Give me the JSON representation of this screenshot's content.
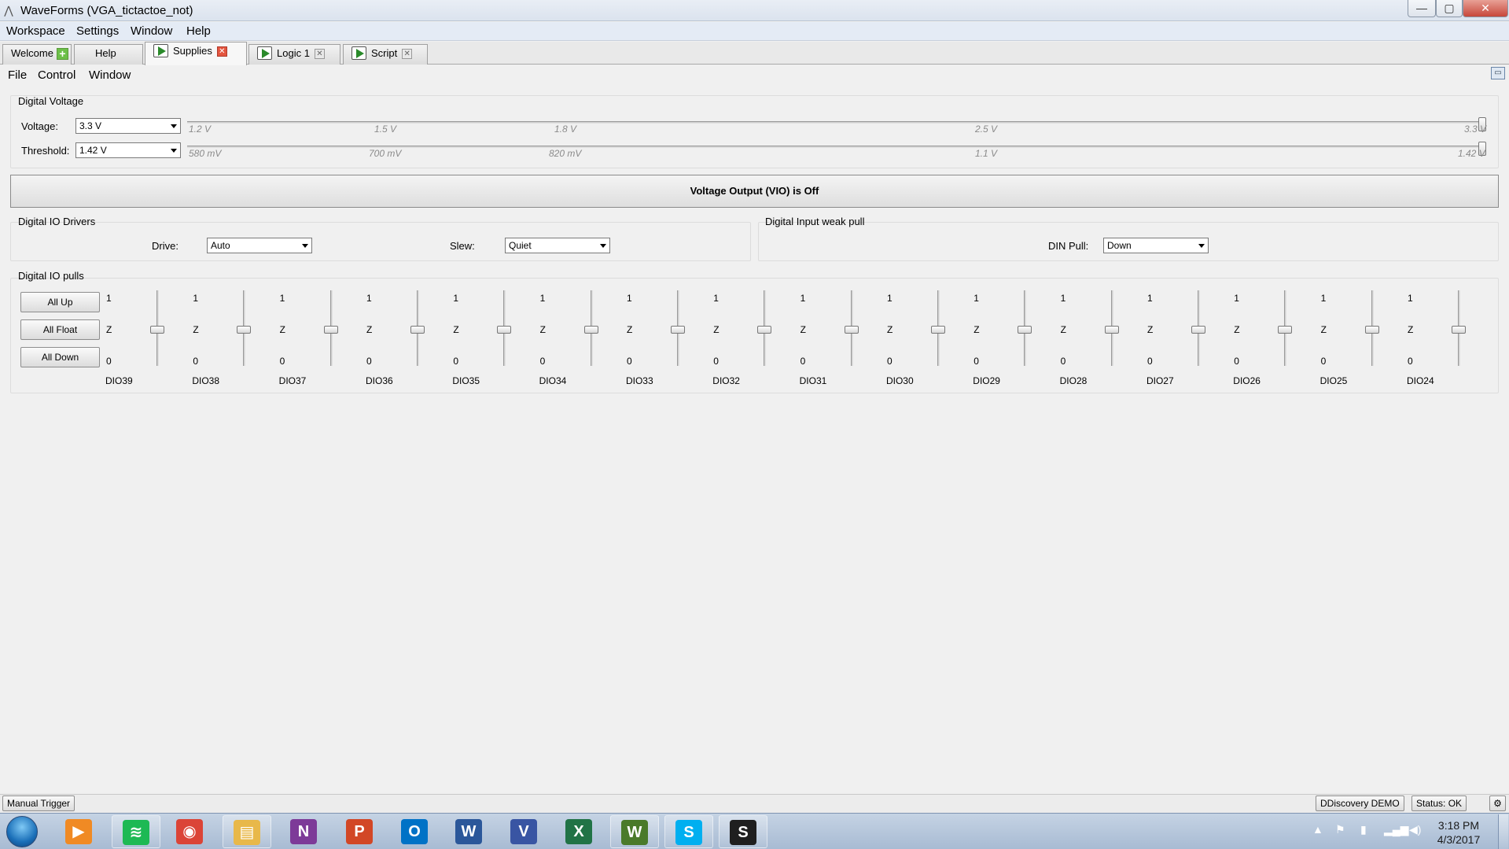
{
  "window": {
    "title": "WaveForms   (VGA_tictactoe_not)",
    "min_glyph": "—",
    "max_glyph": "▢",
    "close_glyph": "✕"
  },
  "app_menu": [
    "Workspace",
    "Settings",
    "Window",
    "Help"
  ],
  "tabs": [
    {
      "label": "Welcome",
      "icon": "plus-icon"
    },
    {
      "label": "Help",
      "icon": ""
    },
    {
      "label": "Supplies",
      "icon": "play-icon",
      "active": true
    },
    {
      "label": "Logic 1",
      "icon": "play-icon"
    },
    {
      "label": "Script",
      "icon": "play-icon"
    }
  ],
  "sub_menu": [
    "File",
    "Control",
    "Window"
  ],
  "digital_voltage": {
    "title": "Digital Voltage",
    "voltage_label": "Voltage:",
    "voltage_value": "3.3 V",
    "voltage_ticks": [
      "1.2 V",
      "1.5 V",
      "1.8 V",
      "2.5 V",
      "3.3 V"
    ],
    "threshold_label": "Threshold:",
    "threshold_value": "1.42 V",
    "threshold_ticks": [
      "580 mV",
      "700 mV",
      "820 mV",
      "1.1 V",
      "1.42 V"
    ]
  },
  "banner": "Voltage Output (VIO) is Off",
  "io_drivers": {
    "title": "Digital IO Drivers",
    "drive_label": "Drive:",
    "drive_value": "Auto",
    "slew_label": "Slew:",
    "slew_value": "Quiet"
  },
  "weak_pull": {
    "title": "Digital Input weak pull",
    "din_label": "DIN Pull:",
    "din_value": "Down"
  },
  "io_pulls": {
    "title": "Digital IO pulls",
    "buttons": [
      "All Up",
      "All Float",
      "All Down"
    ],
    "level_high": "1",
    "level_mid": "Z",
    "level_low": "0",
    "pins": [
      "DIO39",
      "DIO38",
      "DIO37",
      "DIO36",
      "DIO35",
      "DIO34",
      "DIO33",
      "DIO32",
      "DIO31",
      "DIO30",
      "DIO29",
      "DIO28",
      "DIO27",
      "DIO26",
      "DIO25",
      "DIO24"
    ]
  },
  "status_bar": {
    "manual_trigger": "Manual Trigger",
    "device": "DDiscovery DEMO",
    "status": "Status: OK"
  },
  "taskbar": {
    "apps": [
      {
        "name": "media-player-icon",
        "glyph": "▶",
        "color": "#f08a24"
      },
      {
        "name": "spotify-icon",
        "glyph": "≋",
        "color": "#1db954"
      },
      {
        "name": "chrome-icon",
        "glyph": "◉",
        "color": "#db4437"
      },
      {
        "name": "file-explorer-icon",
        "glyph": "▤",
        "color": "#e8b84a"
      },
      {
        "name": "onenote-icon",
        "glyph": "N",
        "color": "#7d3a98"
      },
      {
        "name": "powerpoint-icon",
        "glyph": "P",
        "color": "#d24726"
      },
      {
        "name": "outlook-icon",
        "glyph": "O",
        "color": "#0072c6"
      },
      {
        "name": "word-icon",
        "glyph": "W",
        "color": "#2b579a"
      },
      {
        "name": "visio-icon",
        "glyph": "V",
        "color": "#3955a3"
      },
      {
        "name": "excel-icon",
        "glyph": "X",
        "color": "#217346"
      },
      {
        "name": "waveforms-icon",
        "glyph": "W",
        "color": "#4a7a2a"
      },
      {
        "name": "skype-icon",
        "glyph": "S",
        "color": "#00aff0"
      },
      {
        "name": "app-s-icon",
        "glyph": "S",
        "color": "#1f1f1f"
      }
    ],
    "time": "3:18 PM",
    "date": "4/3/2017"
  }
}
